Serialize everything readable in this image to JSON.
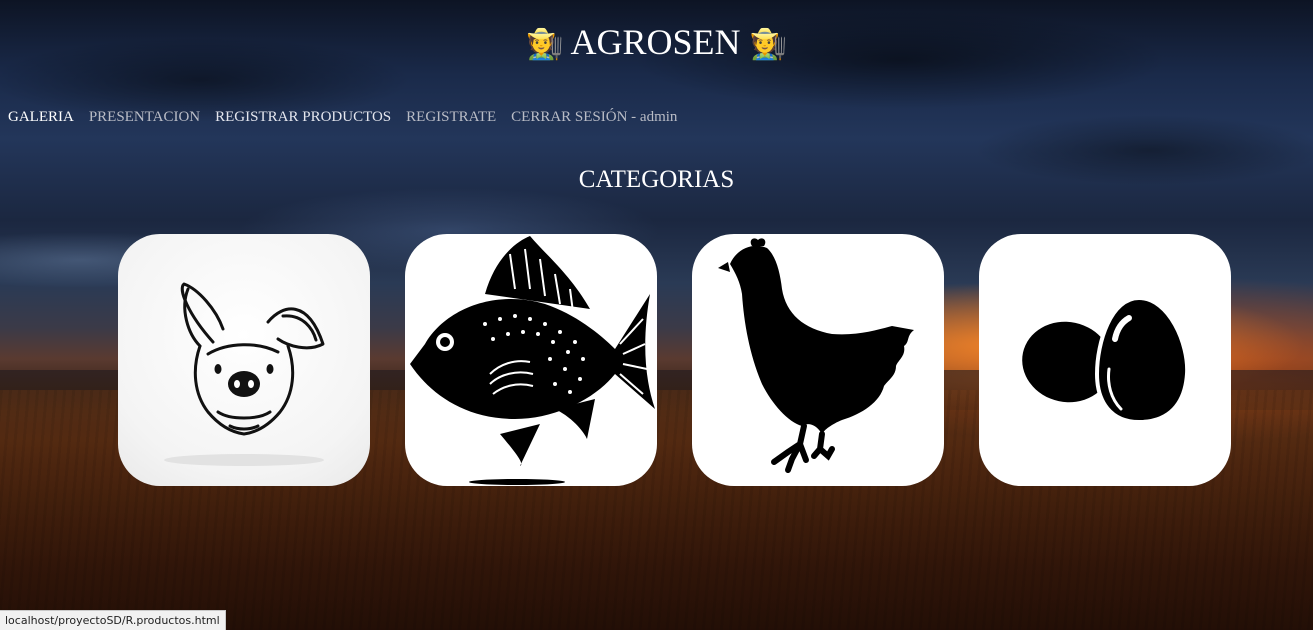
{
  "header": {
    "emoji_left": "🧑‍🌾",
    "title": "AGROSEN",
    "emoji_right": "🧑‍🌾"
  },
  "nav": {
    "galeria": "GALERIA",
    "presentacion": "PRESENTACION",
    "registrar_productos": "REGISTRAR PRODUCTOS",
    "registrate": "REGISTRATE",
    "cerrar_sesion": "CERRAR SESIÓN - admin"
  },
  "main": {
    "section_title": "CATEGORIAS",
    "categories": [
      {
        "icon": "pig-icon"
      },
      {
        "icon": "fish-icon"
      },
      {
        "icon": "hen-icon"
      },
      {
        "icon": "eggs-icon"
      }
    ]
  },
  "status_bar": {
    "url": "localhost/proyectoSD/R.productos.html"
  }
}
